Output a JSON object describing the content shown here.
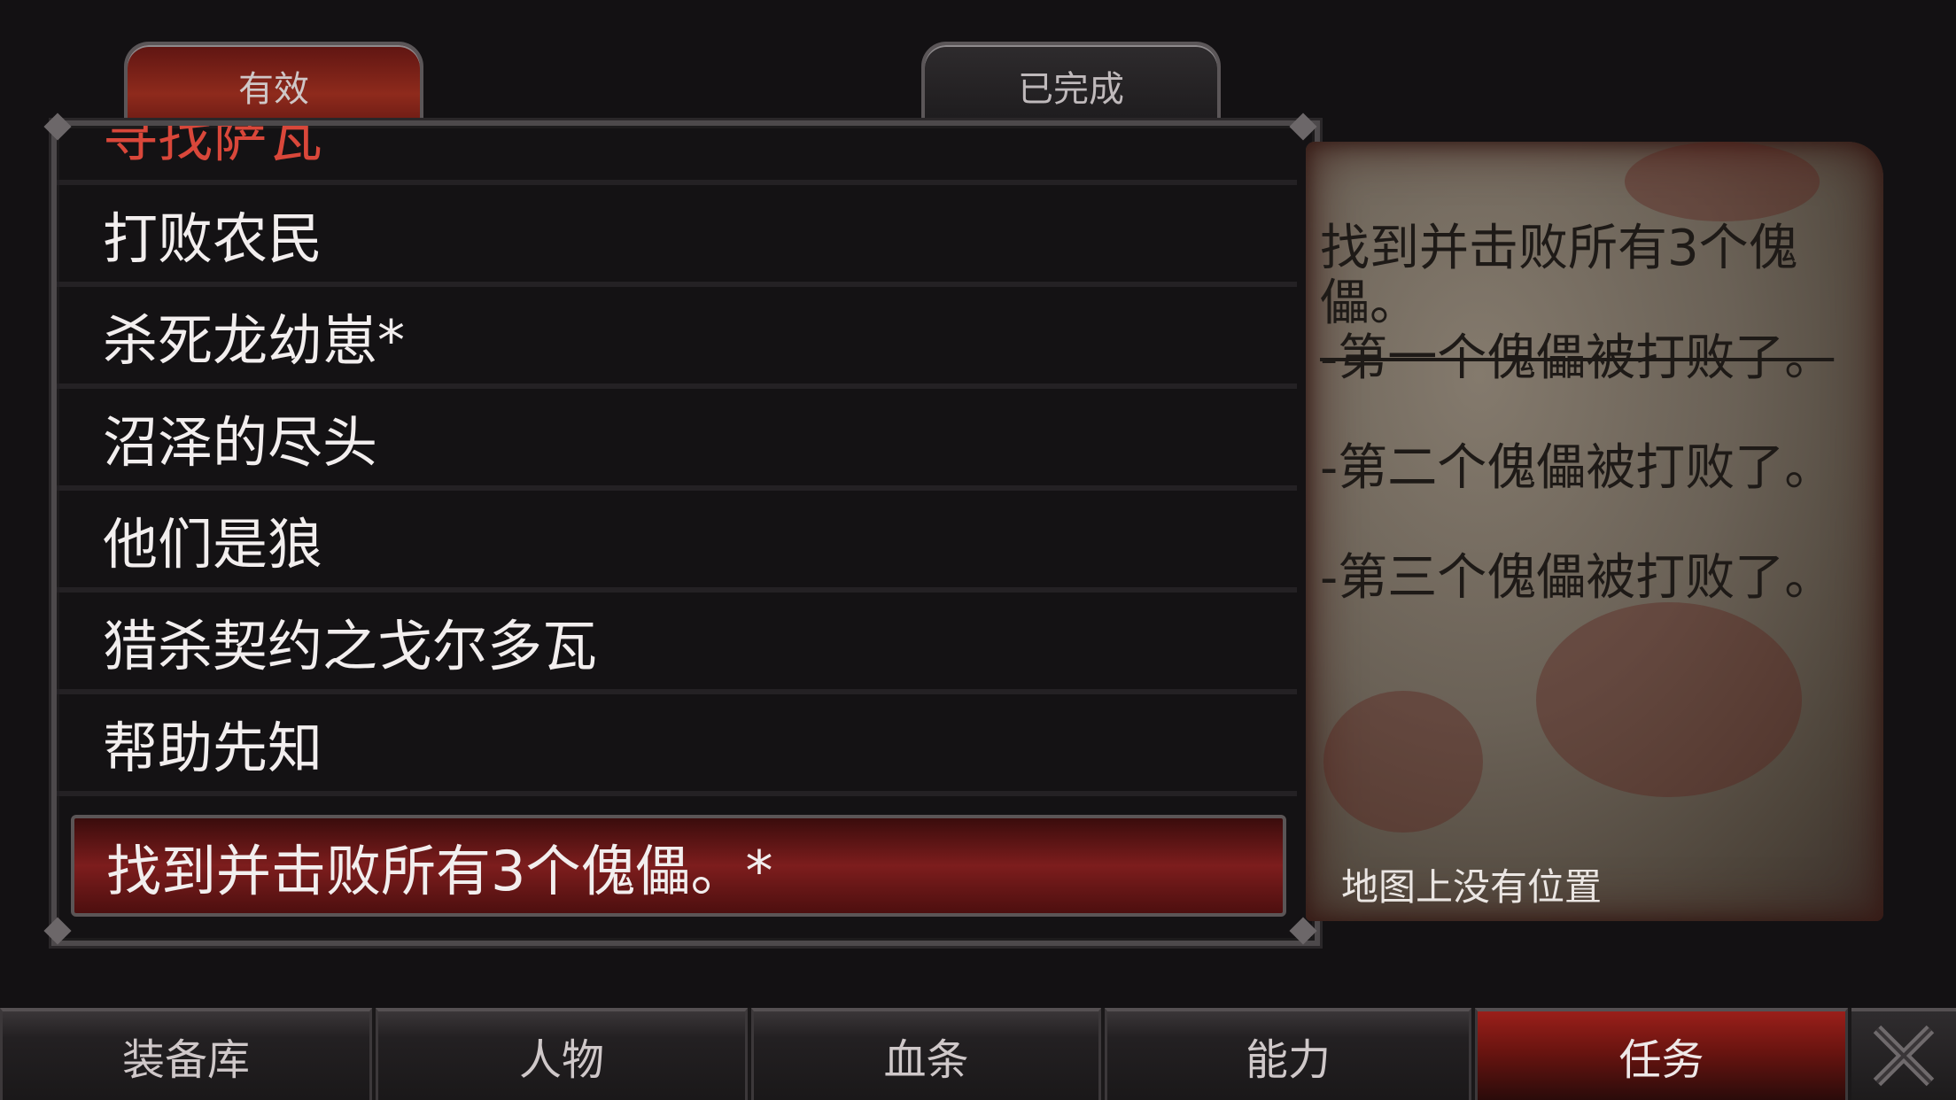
{
  "tabs": {
    "active_label": "有效",
    "completed_label": "已完成"
  },
  "quest_list": {
    "items": [
      "寻找萨瓦",
      "打败农民",
      "杀死龙幼崽*",
      "沼泽的尽头",
      "他们是狼",
      "猎杀契约之戈尔多瓦",
      "帮助先知",
      "找到并击败所有3个傀儡。*"
    ],
    "selected_index": 7
  },
  "quest_details": {
    "title": "找到并击败所有3个傀儡。",
    "objectives": [
      {
        "text": "-第一个傀儡被打败了。",
        "completed": true
      },
      {
        "text": "-第二个傀儡被打败了。",
        "completed": false
      },
      {
        "text": "-第三个傀儡被打败了。",
        "completed": false
      }
    ],
    "map_note": "地图上没有位置"
  },
  "bottom_nav": {
    "items": [
      "装备库",
      "人物",
      "血条",
      "能力",
      "任务"
    ],
    "active_index": 4,
    "close_icon": "close-x-icon"
  },
  "colors": {
    "accent_red": "#8e2a1c",
    "partial_quest_text": "#d9473a",
    "background": "#131113"
  }
}
